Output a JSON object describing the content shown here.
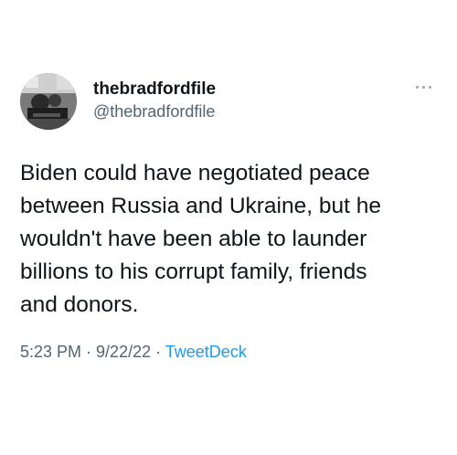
{
  "tweet": {
    "display_name": "thebradfordfile",
    "handle": "@thebradfordfile",
    "more_icon": "more-horizontal-icon",
    "text_lines": [
      "Biden could have negotiated peace",
      "between Russia and Ukraine, but he",
      "wouldn't have been able to launder",
      "billions to his corrupt family, friends",
      "and donors."
    ],
    "time": "5:23 PM",
    "sep1": " · ",
    "date": "9/22/22",
    "sep2": " · ",
    "source": "TweetDeck",
    "colors": {
      "text": "#0f1419",
      "secondary": "#536471",
      "link": "#1d9bf0"
    }
  }
}
